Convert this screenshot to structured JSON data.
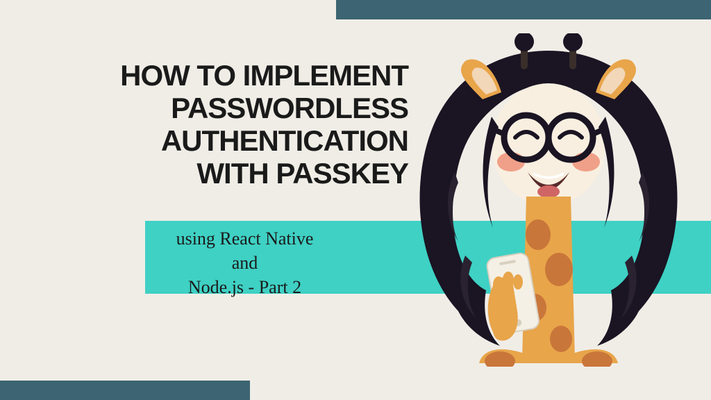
{
  "colors": {
    "background": "#f0ede7",
    "bar": "#3c6472",
    "band": "#3fd1c4",
    "text": "#1a1a1a"
  },
  "title": {
    "line1": "HOW TO IMPLEMENT",
    "line2": "PASSWORDLESS",
    "line3": "AUTHENTICATION",
    "line4": "WITH PASSKEY"
  },
  "subtitle": {
    "line1": "using React Native and",
    "line2": "Node.js - Part 2"
  },
  "mascot": {
    "description": "giraffe-character-with-glasses-and-phone"
  }
}
